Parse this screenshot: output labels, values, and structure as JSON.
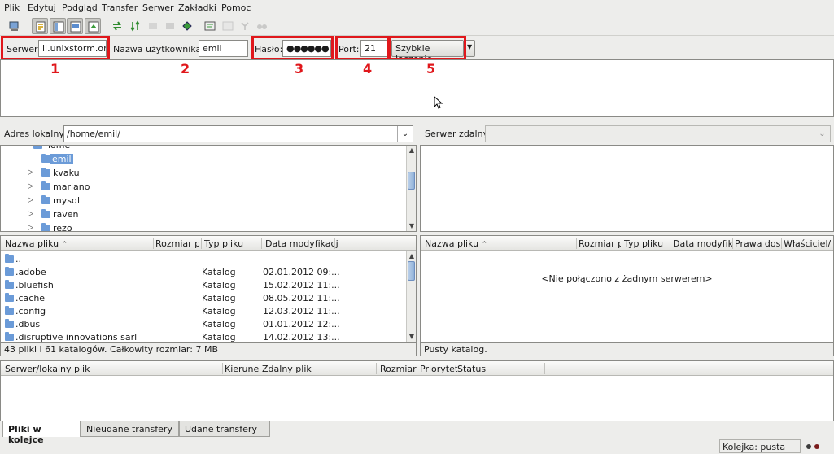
{
  "menu": [
    "Plik",
    "Edytuj",
    "Podgląd",
    "Transfer",
    "Serwer",
    "Zakładki",
    "Pomoc"
  ],
  "toolbar_icons": [
    "site-manager-icon",
    "toggle-log-icon",
    "toggle-local-tree-icon",
    "toggle-remote-tree-icon",
    "toggle-queue-icon",
    "refresh-icon",
    "process-queue-icon",
    "cancel-icon",
    "disconnect-icon",
    "reconnect-icon",
    "filter-icon",
    "compare-icon",
    "sync-browse-icon",
    "search-icon"
  ],
  "quickconnect": {
    "server_label": "Serwer:",
    "server_value": "il.unixstorm.org",
    "user_label": "Nazwa użytkownika:",
    "user_value": "emil",
    "pass_label": "Hasło:",
    "pass_value": "●●●●●●",
    "port_label": "Port:",
    "port_value": "21",
    "connect_button": "Szybkie łączenie",
    "annotations": [
      "1",
      "2",
      "3",
      "4",
      "5"
    ]
  },
  "local": {
    "address_label": "Adres lokalny:",
    "address_value": "/home/emil/",
    "tree": [
      {
        "name": "home",
        "expanded": true
      },
      {
        "name": "emil",
        "selected": true
      },
      {
        "name": "kvaku"
      },
      {
        "name": "mariano"
      },
      {
        "name": "mysql"
      },
      {
        "name": "raven"
      },
      {
        "name": "rezo"
      }
    ],
    "columns": [
      "Nazwa pliku",
      "Rozmiar pli",
      "Typ pliku",
      "Data modyfikacji"
    ],
    "files": [
      {
        "name": "..",
        "type": "",
        "date": ""
      },
      {
        "name": ".adobe",
        "type": "Katalog",
        "date": "02.01.2012 09:..."
      },
      {
        "name": ".bluefish",
        "type": "Katalog",
        "date": "15.02.2012 11:..."
      },
      {
        "name": ".cache",
        "type": "Katalog",
        "date": "08.05.2012 11:..."
      },
      {
        "name": ".config",
        "type": "Katalog",
        "date": "12.03.2012 11:..."
      },
      {
        "name": ".dbus",
        "type": "Katalog",
        "date": "01.01.2012 12:..."
      },
      {
        "name": ".disruptive innovations sarl",
        "type": "Katalog",
        "date": "14.02.2012 13:..."
      }
    ],
    "status": "43 pliki i 61 katalogów. Całkowity rozmiar: 7 MB"
  },
  "remote": {
    "address_label": "Serwer zdalny:",
    "columns": [
      "Nazwa pliku",
      "Rozmiar pl",
      "Typ pliku",
      "Data modyfika",
      "Prawa dostę",
      "Właściciel/G"
    ],
    "empty_message": "<Nie połączono z żadnym serwerem>",
    "status": "Pusty katalog."
  },
  "queue": {
    "columns": [
      "Serwer/lokalny plik",
      "Kierunek",
      "Zdalny plik",
      "Rozmiar",
      "Priorytet",
      "Status"
    ],
    "tabs": [
      "Pliki w kolejce",
      "Nieudane transfery",
      "Udane transfery"
    ],
    "status": "Kolejka: pusta"
  },
  "colors": {
    "annotation": "#e0171b",
    "selection": "#6b9bd8"
  }
}
